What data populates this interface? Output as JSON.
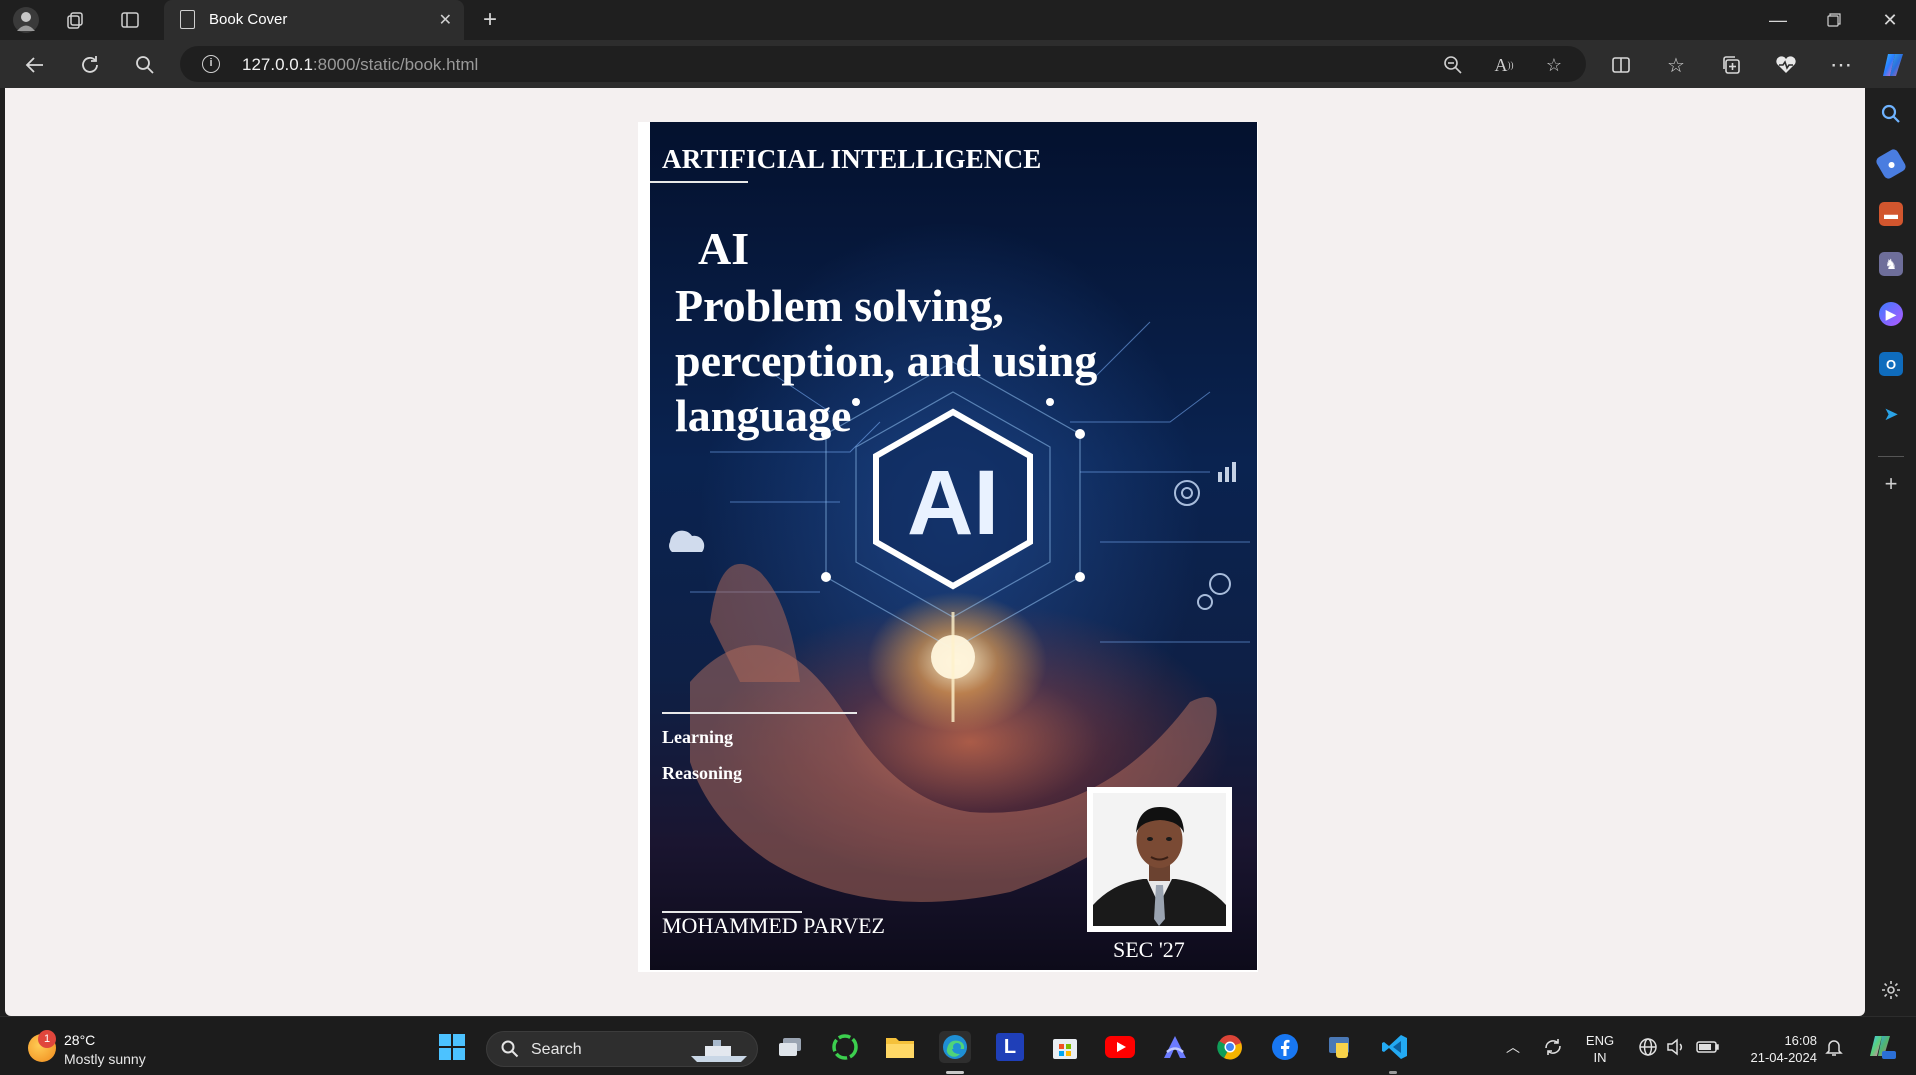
{
  "browser": {
    "tab_title": "Book Cover",
    "url_host": "127.0.0.1",
    "url_rest": ":8000/static/book.html"
  },
  "cover": {
    "heading": "ARTIFICIAL INTELLIGENCE",
    "ai_title": "AI",
    "subtitle": "Problem solving, perception, and using language",
    "art_text": "AI",
    "topics": [
      "Learning",
      "Reasoning"
    ],
    "author": "MOHAMMED PARVEZ",
    "section": "SEC '27"
  },
  "taskbar": {
    "weather_temp": "28°C",
    "weather_desc": "Mostly sunny",
    "weather_badge": "1",
    "search_label": "Search",
    "lang_line1": "ENG",
    "lang_line2": "IN",
    "time": "16:08",
    "date": "21-04-2024"
  },
  "icons": {
    "tab": "page-icon",
    "nav": [
      "back-arrow-icon",
      "refresh-icon",
      "search-icon"
    ],
    "address_bar": [
      "zoom-out-icon",
      "read-aloud-icon",
      "favorite-star-icon"
    ],
    "toolbar": [
      "split-screen-icon",
      "favorites-icon",
      "collections-icon",
      "browser-essentials-icon",
      "more-icon",
      "copilot-icon"
    ],
    "sidebar": [
      "search-icon",
      "shopping-tag-icon",
      "tools-icon",
      "games-icon",
      "copilot-icon",
      "outlook-icon",
      "telegram-icon",
      "add-icon",
      "settings-icon"
    ],
    "taskbar": [
      "start-icon",
      "task-view-icon",
      "green-app-icon",
      "file-explorer-icon",
      "edge-icon",
      "l-app-icon",
      "store-icon",
      "youtube-icon",
      "arc-icon",
      "chrome-icon",
      "facebook-icon",
      "python-icon",
      "vscode-icon"
    ]
  },
  "colors": {
    "chrome_dark": "#1f1f1f",
    "toolbar": "#2d2d2d",
    "page_bg": "#f4f0f0",
    "cover_dark": "#0a2350",
    "glow": "#ffb060"
  }
}
